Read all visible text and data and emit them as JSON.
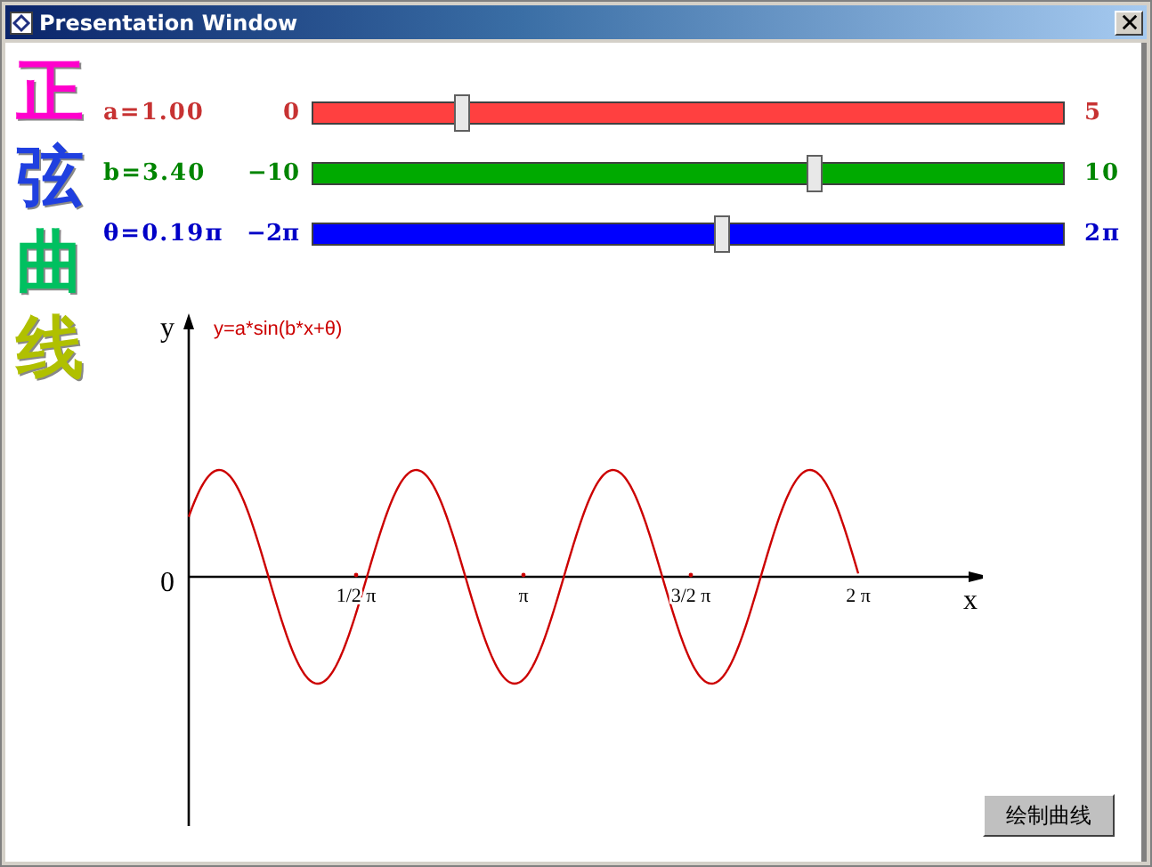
{
  "window": {
    "title": "Presentation Window"
  },
  "side_title": [
    {
      "char": "正",
      "color": "#ff00cc"
    },
    {
      "char": "弦",
      "color": "#2040e0"
    },
    {
      "char": "曲",
      "color": "#00c060"
    },
    {
      "char": "线",
      "color": "#b0c000"
    }
  ],
  "sliders": [
    {
      "label": "a=1.00",
      "min": "0",
      "max": "5",
      "level": 0.2,
      "color": "#ff4040"
    },
    {
      "label": "b=3.40",
      "min": "−10",
      "max": "10",
      "level": 0.67,
      "color": "#00aa00"
    },
    {
      "label": "θ=0.19π",
      "min": "−2π",
      "max": "2π",
      "level": 0.5475,
      "color": "#0000ff"
    }
  ],
  "plot": {
    "y_label": "y",
    "formula": "y=a*sin(b*x+θ)",
    "origin_label": "0",
    "x_label": "x",
    "x_ticks": [
      "1/2 π",
      "π",
      "3/2 π",
      "2 π"
    ]
  },
  "draw_button": {
    "label": "绘制曲线"
  }
}
